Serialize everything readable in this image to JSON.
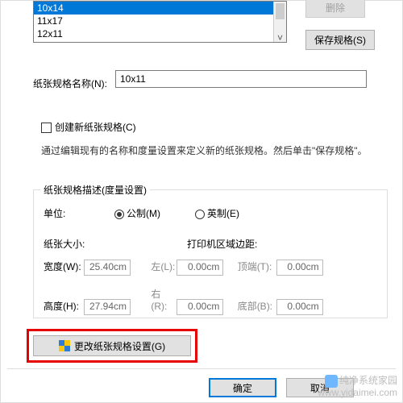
{
  "list": {
    "items": [
      "10x14",
      "11x17",
      "12x11"
    ],
    "selected": 0
  },
  "buttons": {
    "delete": "删除",
    "save": "保存规格(S)",
    "change": "更改纸张规格设置(G)",
    "ok": "确定",
    "cancel": "取消"
  },
  "name": {
    "label": "纸张规格名称(N):",
    "value": "10x11"
  },
  "createNew": {
    "label": "创建新纸张规格(C)"
  },
  "desc": "通过编辑现有的名称和度量设置来定义新的纸张规格。然后单击\"保存规格\"。",
  "group": {
    "legend": "纸张规格描述(度量设置)",
    "unitLabel": "单位:",
    "metric": "公制(M)",
    "imperial": "英制(E)",
    "sizeLabel": "纸张大小:",
    "marginLabel": "打印机区域边距:",
    "width": {
      "label": "宽度(W):",
      "value": "25.40cm"
    },
    "height": {
      "label": "高度(H):",
      "value": "27.94cm"
    },
    "left": {
      "label": "左(L):",
      "value": "0.00cm"
    },
    "right": {
      "label": "右(R):",
      "value": "0.00cm"
    },
    "top": {
      "label": "顶端(T):",
      "value": "0.00cm"
    },
    "bottom": {
      "label": "底部(B):",
      "value": "0.00cm"
    }
  },
  "watermark": {
    "line1": "纯净系统家园",
    "line2": "www.yidaimei.com"
  }
}
